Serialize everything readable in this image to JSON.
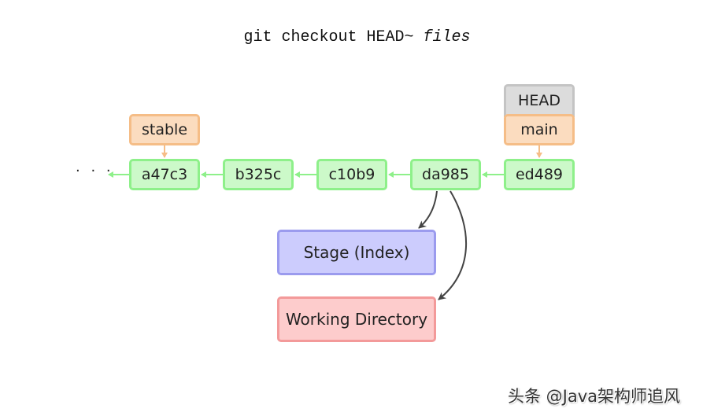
{
  "title": {
    "command": "git checkout HEAD~",
    "argument": "files"
  },
  "ellipsis": "· · ·",
  "commits": [
    {
      "id": "a47c3"
    },
    {
      "id": "b325c"
    },
    {
      "id": "c10b9"
    },
    {
      "id": "da985"
    },
    {
      "id": "ed489"
    }
  ],
  "refs": {
    "stable": "stable",
    "main": "main",
    "head": "HEAD"
  },
  "areas": {
    "stage": "Stage (Index)",
    "working_directory": "Working Directory"
  },
  "colors": {
    "commit_fill": "#ccf9c9",
    "commit_border": "#8ef08a",
    "branch_fill": "#fbdcbf",
    "branch_border": "#f5bd87",
    "head_fill": "#dcdcdc",
    "head_border": "#c4c4c4",
    "stage_fill": "#ccccfd",
    "stage_border": "#9b9bee",
    "workdir_fill": "#fdcccc",
    "workdir_border": "#f39a9a",
    "checkout_arrow": "#444444"
  },
  "watermark": "头条 @Java架构师追风"
}
